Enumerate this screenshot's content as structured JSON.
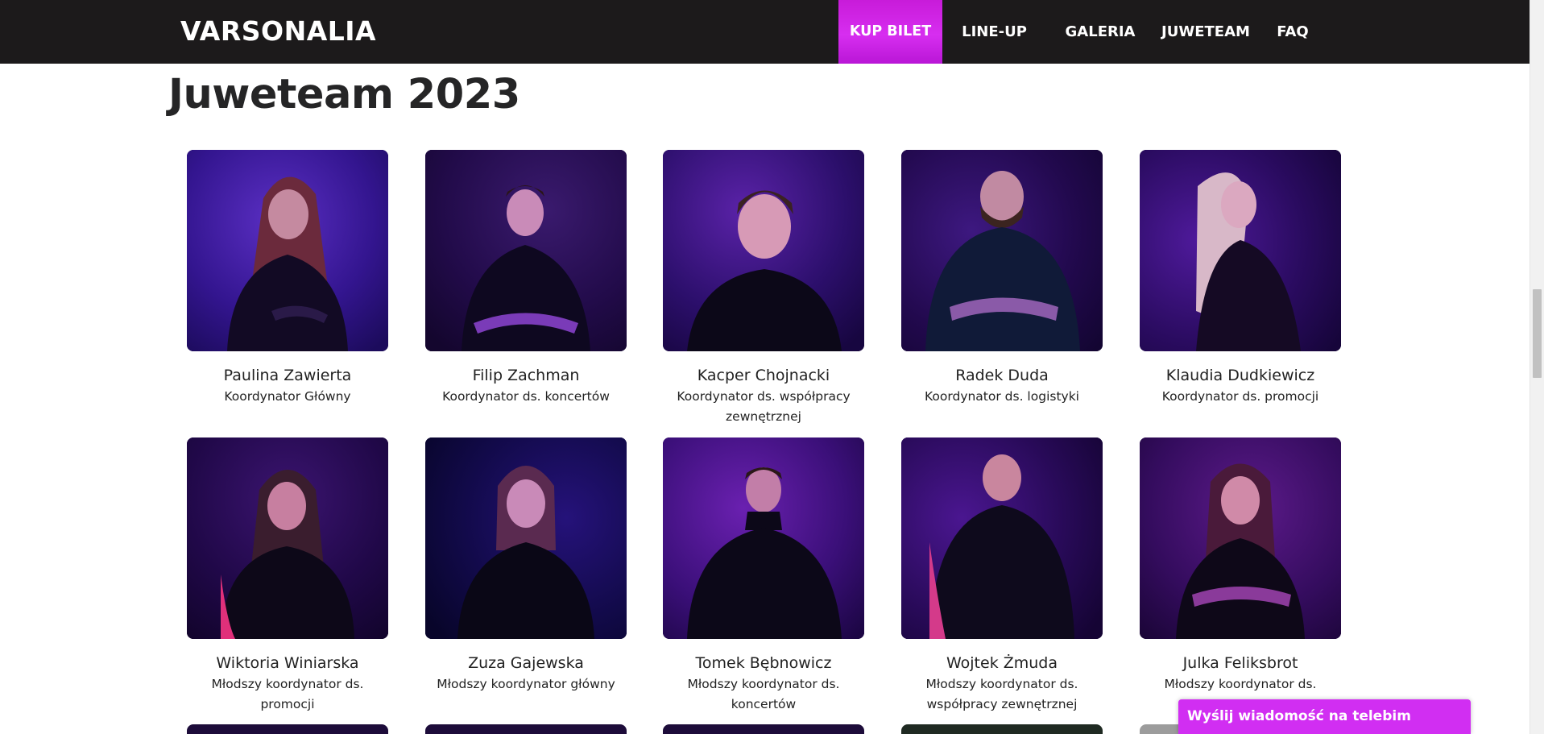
{
  "header": {
    "logo": "VARSONALIA",
    "nav": [
      "KUP BILET",
      "LINE-UP",
      "GALERIA",
      "JUWETEAM",
      "FAQ"
    ],
    "highlight_color": "#d12ef2",
    "bar_color": "#1c1a1b"
  },
  "main": {
    "title": "Juweteam 2023",
    "members": [
      {
        "name": "Paulina Zawierta",
        "role": "Koordynator Główny"
      },
      {
        "name": "Filip Zachman",
        "role": "Koordynator ds. koncertów"
      },
      {
        "name": "Kacper Chojnacki",
        "role": "Koordynator ds. współpracy zewnętrznej"
      },
      {
        "name": "Radek Duda",
        "role": "Koordynator ds. logistyki"
      },
      {
        "name": "Klaudia Dudkiewicz",
        "role": "Koordynator ds. promocji"
      },
      {
        "name": "Wiktoria Winiarska",
        "role": "Młodszy koordynator ds. promocji"
      },
      {
        "name": "Zuza Gajewska",
        "role": "Młodszy koordynator główny"
      },
      {
        "name": "Tomek Bębnowicz",
        "role": "Młodszy koordynator ds. koncertów"
      },
      {
        "name": "Wojtek Żmuda",
        "role": "Młodszy koordynator ds. współpracy zewnętrznej"
      },
      {
        "name": "Julka Feliksbrot",
        "role": "Młodszy koordynator ds."
      }
    ]
  },
  "telebim": {
    "label": "Wyślij wiadomość na telebim"
  }
}
